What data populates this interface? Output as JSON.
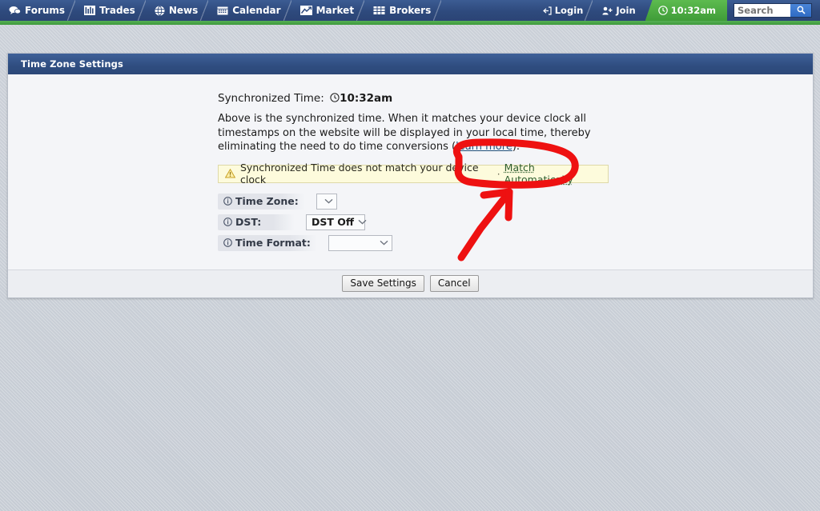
{
  "topnav": {
    "left_items": [
      {
        "label": "Forums",
        "icon": "speech-bubbles-icon"
      },
      {
        "label": "Trades",
        "icon": "bar-chart-icon"
      },
      {
        "label": "News",
        "icon": "globe-icon"
      },
      {
        "label": "Calendar",
        "icon": "calendar-icon"
      },
      {
        "label": "Market",
        "icon": "line-chart-icon"
      },
      {
        "label": "Brokers",
        "icon": "grid-table-icon"
      }
    ],
    "login_label": "Login",
    "login_icon": "login-arrow-icon",
    "join_label": "Join",
    "join_icon": "person-plus-icon",
    "clock_label": "10:32am",
    "clock_icon": "clock-icon",
    "search_placeholder": "Search",
    "search_value": "",
    "search_icon": "magnifier-icon",
    "nav_bg": "#2e4a7d",
    "accent_green": "#4aa84a"
  },
  "panel": {
    "title": "Time Zone Settings"
  },
  "content": {
    "sync_label": "Synchronized Time:",
    "sync_clock_icon": "clock-icon",
    "sync_time": "10:32am",
    "description": "Above is the synchronized time. When it matches your device clock all timestamps on the website will be displayed in your local time, thereby eliminating the need to do time conversions (",
    "learn_more_label": "learn more",
    "description_tail": ").",
    "warning": {
      "icon": "warning-triangle-icon",
      "text": "Synchronized Time does not match your device clock",
      "separator": "·",
      "action_label": "Match Automatically",
      "bg_color": "#fdfbdc",
      "border_color": "#ded9a8"
    },
    "rows": [
      {
        "label": "Time Zone:",
        "icon": "info-icon",
        "value": "",
        "select_name": "timezone-select"
      },
      {
        "label": "DST:",
        "icon": "info-icon",
        "value": "DST Off",
        "select_name": "dst-select"
      },
      {
        "label": "Time Format:",
        "icon": "info-icon",
        "value": "",
        "select_name": "time-format-select"
      }
    ]
  },
  "footer": {
    "save_label": "Save Settings",
    "cancel_label": "Cancel"
  },
  "annotation": {
    "color": "#ee1111",
    "shapes": [
      "highlight-oval",
      "pointer-arrow"
    ]
  }
}
